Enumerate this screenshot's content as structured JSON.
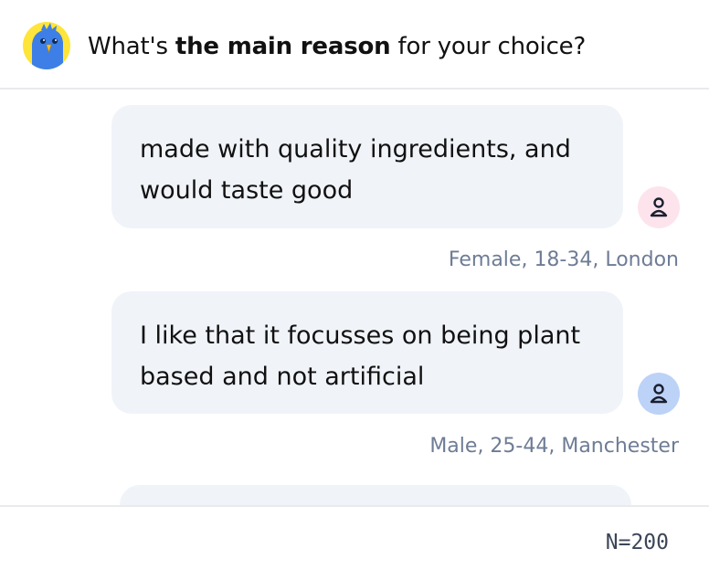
{
  "header": {
    "logo_icon": "bird-mascot-icon",
    "question_prefix": "What's ",
    "question_bold": "the main reason",
    "question_suffix": " for your choice?"
  },
  "responses": [
    {
      "text": "made with quality ingredients, and would taste good",
      "respondent": "Female, 18-34, London",
      "avatar_icon": "person-icon",
      "avatar_color": "#fde4ec"
    },
    {
      "text": "I like that it focusses on being plant based and not artificial",
      "respondent": "Male, 25-44, Manchester",
      "avatar_icon": "person-icon",
      "avatar_color": "#bcd2f7"
    }
  ],
  "footer": {
    "sample_size": "N=200"
  },
  "colors": {
    "bubble": "#f0f3f8",
    "meta_text": "#6e7c95",
    "logo_bg": "#ffe43a",
    "logo_bird": "#3d7fe6"
  }
}
